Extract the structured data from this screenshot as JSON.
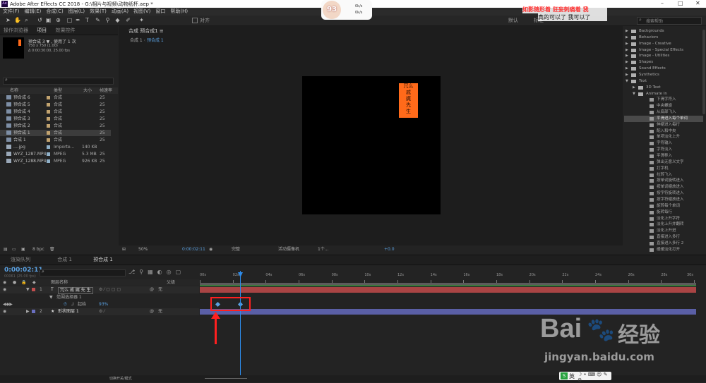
{
  "window": {
    "title": "Adobe After Effects CC 2018 - G:\\相片与视频\\动物纸杯.aep *",
    "min": "–",
    "max": "□",
    "close": "✕"
  },
  "menu": [
    "文件(F)",
    "编辑(E)",
    "合成(C)",
    "图层(L)",
    "效果(T)",
    "动画(A)",
    "视图(V)",
    "窗口",
    "帮助(H)"
  ],
  "overlay_text": {
    "line1": "如影随形着  狂妄刺痛着  我",
    "line2": "真的可以了  我可以了"
  },
  "overlay_badge": {
    "avatar": "93",
    "stat1": "0k/s",
    "stat2": "0k/s"
  },
  "toolbar_right": {
    "default": "默认",
    "std": "标准",
    "search_help": "搜索帮助",
    "align": "对齐"
  },
  "project": {
    "tabs": [
      "操作浏览器",
      "项目",
      "效果控件"
    ],
    "preview_name": "预合成 3 ▼ , 使用了 1 次",
    "preview_info1": "750 x 750 (1.00)",
    "preview_info2": "Δ 0:00:30:00, 25.00 fps",
    "search_placeholder": "",
    "columns": [
      "名称",
      "类型",
      "大小",
      "帧速率"
    ],
    "items": [
      {
        "name": "预合成 6",
        "type": "合成",
        "size": "",
        "fps": "25",
        "color": "#c2a36f",
        "kind": "comp"
      },
      {
        "name": "预合成 5",
        "type": "合成",
        "size": "",
        "fps": "25",
        "color": "#c2a36f",
        "kind": "comp"
      },
      {
        "name": "预合成 4",
        "type": "合成",
        "size": "",
        "fps": "25",
        "color": "#c2a36f",
        "kind": "comp"
      },
      {
        "name": "预合成 3",
        "type": "合成",
        "size": "",
        "fps": "25",
        "color": "#c2a36f",
        "kind": "comp"
      },
      {
        "name": "预合成 2",
        "type": "合成",
        "size": "",
        "fps": "25",
        "color": "#c2a36f",
        "kind": "comp"
      },
      {
        "name": "预合成 1",
        "type": "合成",
        "size": "",
        "fps": "25",
        "color": "#c2a36f",
        "kind": "comp",
        "selected": true
      },
      {
        "name": "合成 1",
        "type": "合成",
        "size": "",
        "fps": "25",
        "color": "#c2a36f",
        "kind": "comp"
      },
      {
        "name": "....jpg",
        "type": "Importe...",
        "size": "140 KB",
        "fps": "",
        "color": "#8fb0c8",
        "kind": "file"
      },
      {
        "name": "WYZ_1287.MP4",
        "type": "MPEG",
        "size": "5.3 MB",
        "fps": "25",
        "color": "#8fb0c8",
        "kind": "file"
      },
      {
        "name": "WYZ_1288.MP4",
        "type": "MPEG",
        "size": "926 KB",
        "fps": "25",
        "color": "#8fb0c8",
        "kind": "file"
      }
    ],
    "bpc": "8 bpc"
  },
  "composition": {
    "tab": "合成 预合成1 ≡",
    "breadcrumbs": [
      "合成 1",
      "预合成 1"
    ],
    "canvas_text": [
      "冗么",
      "戚",
      "娓",
      "先",
      "生"
    ],
    "zoom": "50%",
    "timecode": "0:00:02:11",
    "quality": "完整",
    "camera": "活动摄像机",
    "views": "1个...",
    "exposure": "+0.0"
  },
  "effects": {
    "items": [
      {
        "label": "Backgrounds",
        "level": 0,
        "kind": "folder"
      },
      {
        "label": "Behaviors",
        "level": 0,
        "kind": "folder"
      },
      {
        "label": "Image - Creative",
        "level": 0,
        "kind": "folder"
      },
      {
        "label": "Image - Special Effects",
        "level": 0,
        "kind": "folder"
      },
      {
        "label": "Image - Utilities",
        "level": 0,
        "kind": "folder"
      },
      {
        "label": "Shapes",
        "level": 0,
        "kind": "folder"
      },
      {
        "label": "Sound Effects",
        "level": 0,
        "kind": "folder"
      },
      {
        "label": "Synthetics",
        "level": 0,
        "kind": "folder"
      },
      {
        "label": "Text",
        "level": 0,
        "kind": "folder",
        "open": true
      },
      {
        "label": "3D Text",
        "level": 1,
        "kind": "folder"
      },
      {
        "label": "Animate In",
        "level": 1,
        "kind": "folder",
        "open": true
      },
      {
        "label": "下滑字符入",
        "level": 2,
        "kind": "preset"
      },
      {
        "label": "中央螺旋",
        "level": 2,
        "kind": "preset"
      },
      {
        "label": "从底部飞入",
        "level": 2,
        "kind": "preset"
      },
      {
        "label": "平滑进入每个单词",
        "level": 2,
        "kind": "preset",
        "selected": true
      },
      {
        "label": "伸缩进入每行",
        "level": 2,
        "kind": "preset"
      },
      {
        "label": "配入和中央",
        "level": 2,
        "kind": "preset"
      },
      {
        "label": "单项淡化上升",
        "level": 2,
        "kind": "preset"
      },
      {
        "label": "字符输入",
        "level": 2,
        "kind": "preset"
      },
      {
        "label": "字符淡入",
        "level": 2,
        "kind": "preset"
      },
      {
        "label": "平滑移入",
        "level": 2,
        "kind": "preset"
      },
      {
        "label": "弹出无意义文字",
        "level": 2,
        "kind": "preset"
      },
      {
        "label": "打字机",
        "level": 2,
        "kind": "preset"
      },
      {
        "label": "拉转飞入",
        "level": 2,
        "kind": "preset"
      },
      {
        "label": "按单词旋转进入",
        "level": 2,
        "kind": "preset"
      },
      {
        "label": "按单词缩放进入",
        "level": 2,
        "kind": "preset"
      },
      {
        "label": "按字符旋转进入",
        "level": 2,
        "kind": "preset"
      },
      {
        "label": "按字符缩放进入",
        "level": 2,
        "kind": "preset"
      },
      {
        "label": "旋转每个单词",
        "level": 2,
        "kind": "preset"
      },
      {
        "label": "旋转每行",
        "level": 2,
        "kind": "preset"
      },
      {
        "label": "淡化上升字符",
        "level": 2,
        "kind": "preset"
      },
      {
        "label": "淡化上升并翻转",
        "level": 2,
        "kind": "preset"
      },
      {
        "label": "淡化上升进",
        "level": 2,
        "kind": "preset"
      },
      {
        "label": "直接进入多行",
        "level": 2,
        "kind": "preset"
      },
      {
        "label": "直接进入多行 2",
        "level": 2,
        "kind": "preset"
      },
      {
        "label": "缓缓淡化打开",
        "level": 2,
        "kind": "preset"
      }
    ]
  },
  "timeline": {
    "tabs": [
      "渲染队列",
      "合成 1",
      "预合成 1"
    ],
    "timecode": "0:00:02:11",
    "frames": "00061 (25.00 fps)",
    "columns": {
      "name": "图层名称",
      "parent": "父级"
    },
    "ruler": [
      "00s",
      "02s",
      "04s",
      "06s",
      "08s",
      "10s",
      "12s",
      "14s",
      "16s",
      "18s",
      "20s",
      "22s",
      "24s",
      "26s",
      "28s",
      "30s"
    ],
    "layers": [
      {
        "num": "1",
        "type": "T",
        "name": "冗么 戚 娓 先 生",
        "parent": "无",
        "color": "#c24e4e"
      },
      {
        "num": "",
        "type": "",
        "name": "范围选择器 1",
        "parent": "",
        "color": ""
      },
      {
        "num": "",
        "type": "",
        "name": "起始",
        "parent": "",
        "value": "93%",
        "color": ""
      },
      {
        "num": "2",
        "type": "★",
        "name": "形状图层 1",
        "parent": "无",
        "color": "#6a6fc0"
      }
    ],
    "footer": "切换开关/模式"
  },
  "watermark": {
    "brand": "Bai",
    "brand2": "经验",
    "url": "jingyan.baidu.com"
  },
  "taskbar": {
    "ime": "英"
  },
  "colors": {
    "accent": "#2d8ceb",
    "layer_red": "#a94444",
    "layer_blue": "#5a5fa6",
    "highlight_orange": "#ff6a1a",
    "annotation": "#ff2020"
  }
}
